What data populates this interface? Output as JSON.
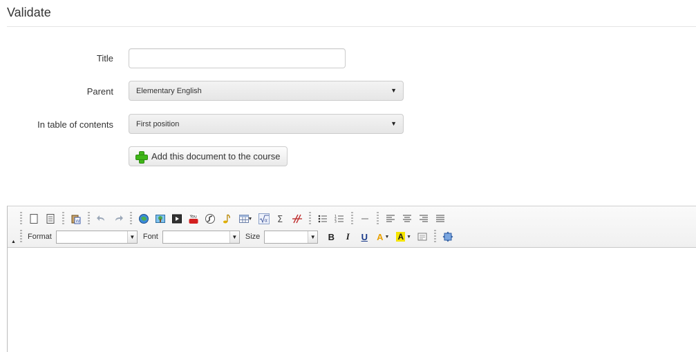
{
  "page": {
    "title": "Validate"
  },
  "form": {
    "title_label": "Title",
    "title_value": "",
    "parent_label": "Parent",
    "parent_value": "Elementary English",
    "toc_label": "In table of contents",
    "toc_value": "First position",
    "add_button_label": "Add this document to the course",
    "select_arrow": "▼"
  },
  "editor": {
    "toolbar_row1": [
      "new-page-icon",
      "templates-icon",
      "paste-word-icon",
      "undo-icon",
      "redo-icon",
      "link-icon",
      "image-icon",
      "video-icon",
      "youtube-icon",
      "flash-icon",
      "audio-icon",
      "table-icon",
      "math-formula-icon",
      "sigma-icon",
      "graph-icon",
      "bulleted-list-icon",
      "numbered-list-icon",
      "horizontal-rule-icon",
      "align-left-icon",
      "align-center-icon",
      "align-right-icon",
      "justify-icon"
    ],
    "format_label": "Format",
    "font_label": "Font",
    "size_label": "Size",
    "bold_label": "B",
    "italic_label": "I",
    "underline_label": "U",
    "text_color_label": "A",
    "bg_color_label": "A",
    "youtube_text": "You",
    "combo_arrow": "▼",
    "collapse_arrow": "▲",
    "accent_colors": {
      "bg_highlight": "#f5e500",
      "text_orange": "#e8a000",
      "add_green": "#3fb618"
    }
  }
}
